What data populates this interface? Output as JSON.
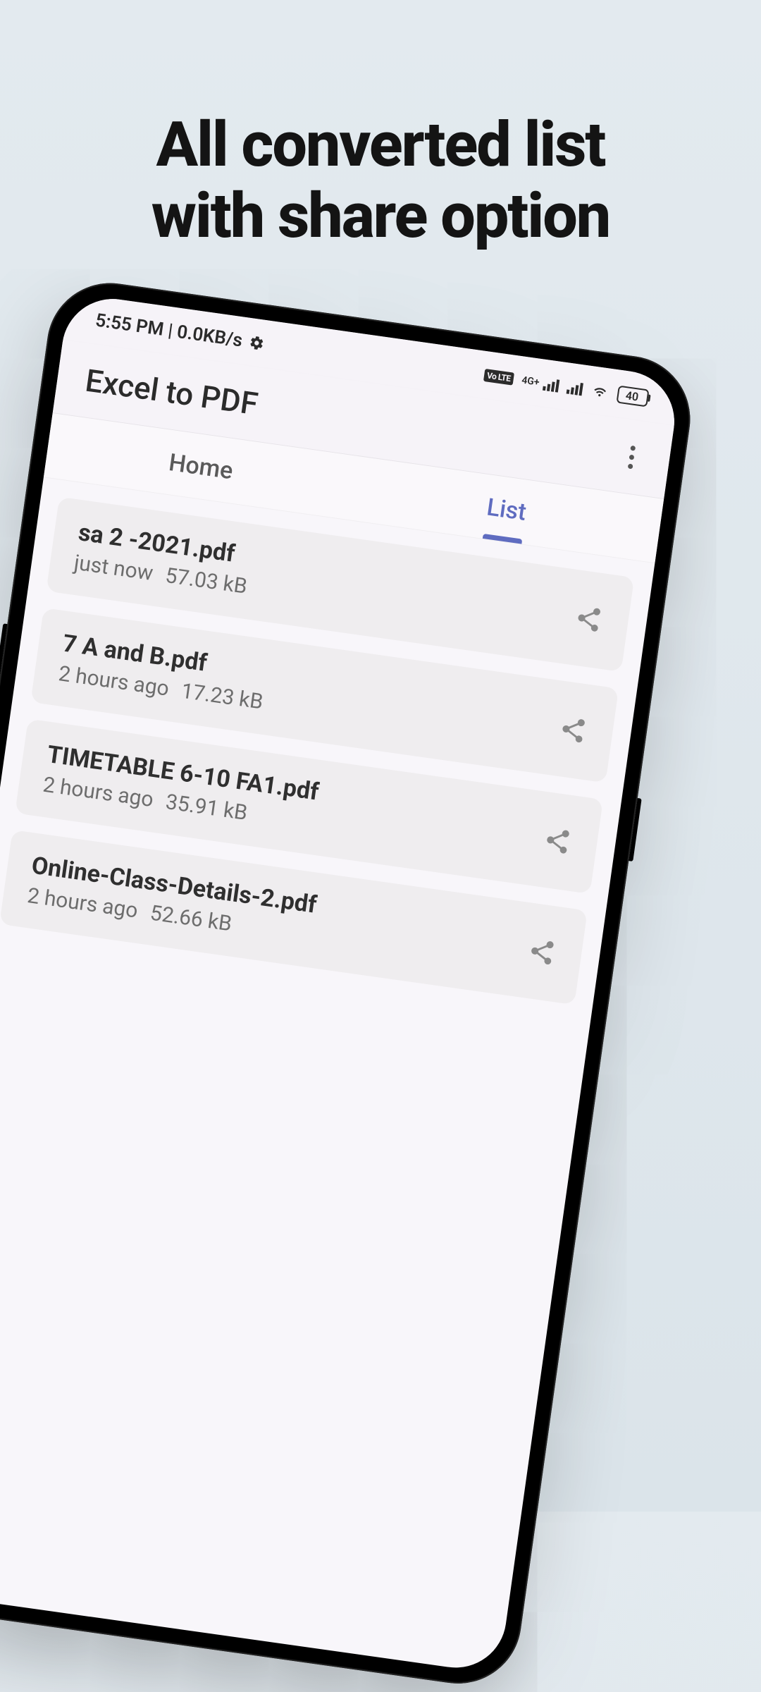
{
  "promo": {
    "line1": "All converted list",
    "line2": "with share option"
  },
  "statusbar": {
    "time_net": "5:55 PM | 0.0KB/s",
    "volte": "Vo LTE",
    "net_gen": "4G+",
    "battery": "40"
  },
  "appbar": {
    "title": "Excel to PDF"
  },
  "tabs": {
    "home": "Home",
    "list": "List"
  },
  "files": [
    {
      "name": "sa 2 -2021.pdf",
      "time": "just now",
      "size": "57.03 kB"
    },
    {
      "name": "7 A and B.pdf",
      "time": "2 hours ago",
      "size": "17.23 kB"
    },
    {
      "name": "TIMETABLE 6-10 FA1.pdf",
      "time": "2 hours ago",
      "size": "35.91 kB"
    },
    {
      "name": "Online-Class-Details-2.pdf",
      "time": "2 hours ago",
      "size": "52.66 kB"
    }
  ]
}
